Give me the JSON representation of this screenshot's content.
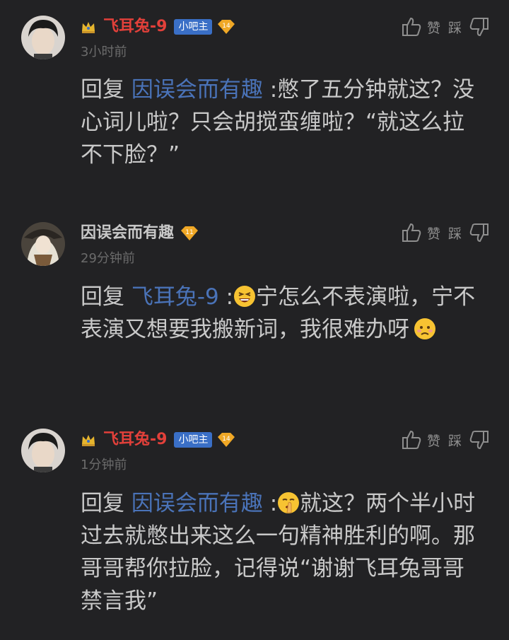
{
  "comments": [
    {
      "username": "飞耳兔-9",
      "role_badge": "小吧主",
      "level": "14",
      "time": "3小时前",
      "like_label": "赞",
      "dislike_label": "踩",
      "reply_prefix": "回复",
      "reply_to": "因误会而有趣",
      "text_part1": "憋了五分钟就这？没心词儿啦？只会胡搅蛮缠啦？“就这么拉不下脸？”"
    },
    {
      "username": "因误会而有趣",
      "level": "11",
      "time": "29分钟前",
      "like_label": "赞",
      "dislike_label": "踩",
      "reply_prefix": "回复",
      "reply_to": "飞耳兔-9",
      "text_part1": "宁怎么不表演啦，宁不表演又想要我搬新词，我很难办呀"
    },
    {
      "username": "飞耳兔-9",
      "role_badge": "小吧主",
      "level": "14",
      "time": "1分钟前",
      "like_label": "赞",
      "dislike_label": "踩",
      "reply_prefix": "回复",
      "reply_to": "因误会而有趣",
      "text_part1": "就这？两个半小时过去就憋出来这么一句精神胜利的啊。那哥哥帮你拉脸，记得说“谢谢飞耳兔哥哥禁言我”"
    }
  ],
  "colors": {
    "background": "#222224",
    "username_highlight": "#e2403a",
    "link": "#4a73b8",
    "role_badge": "#3a6fc6",
    "time": "#6b6b6b"
  },
  "icons": [
    "crown-icon",
    "level-badge-icon",
    "thumbs-up-icon",
    "thumbs-down-icon",
    "grinning-squint-emoji",
    "worried-emoji",
    "shushing-emoji"
  ]
}
